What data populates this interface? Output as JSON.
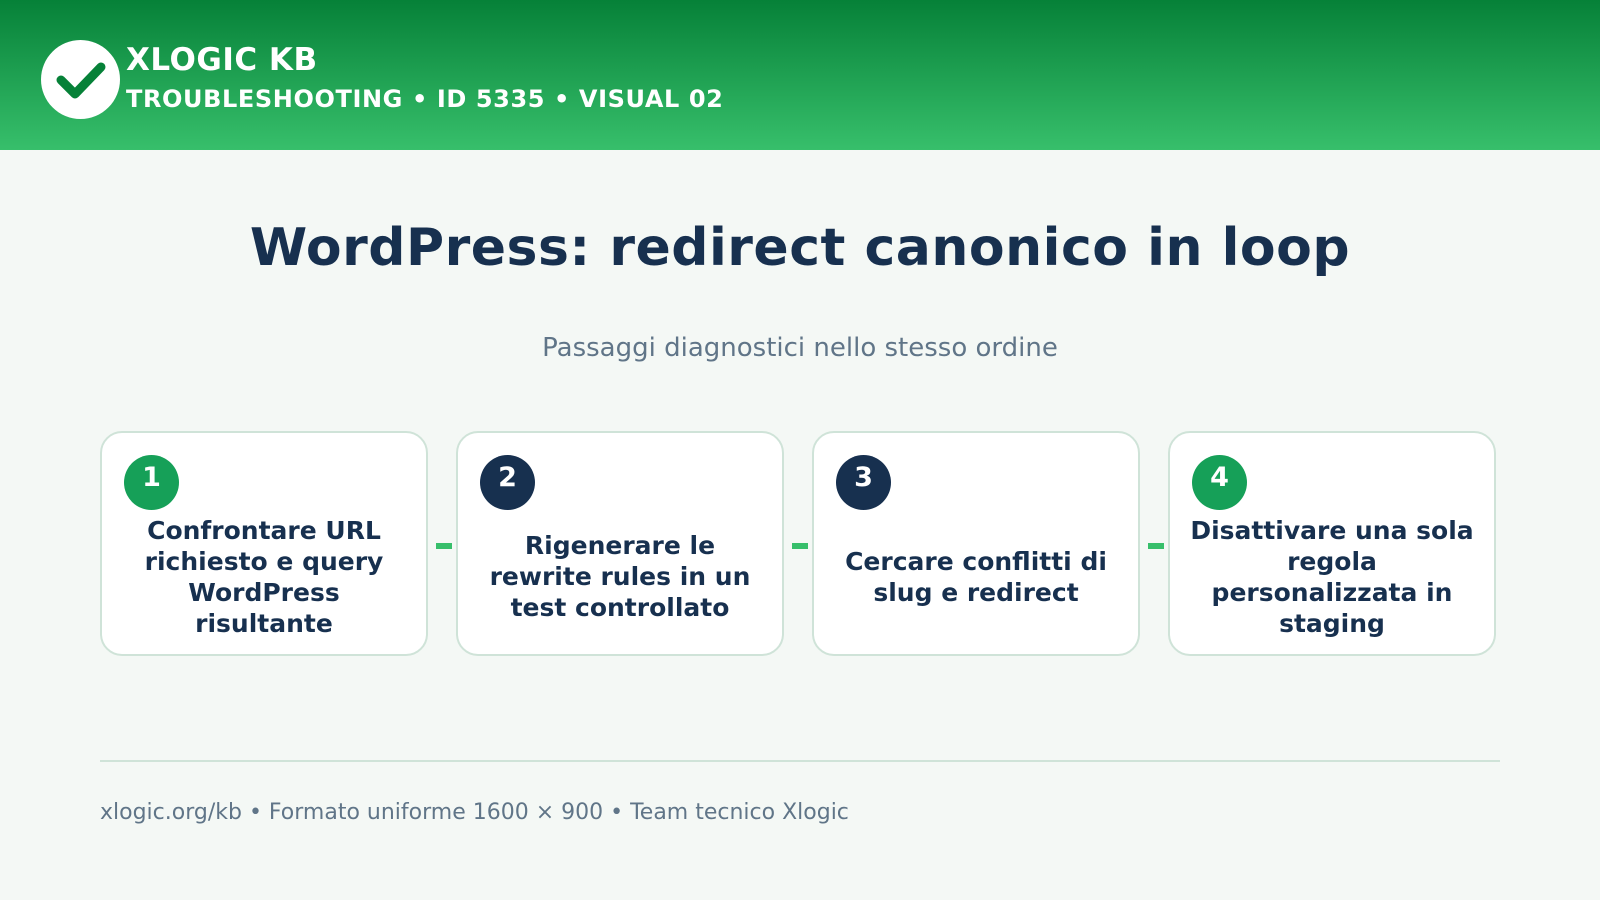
{
  "header": {
    "brand": "XLOGIC KB",
    "breadcrumb": "TROUBLESHOOTING • ID 5335 • VISUAL 02",
    "logo_icon": "checkmark-icon"
  },
  "main": {
    "title": "WordPress: redirect canonico in loop",
    "subtitle": "Passaggi diagnostici nello stesso ordine",
    "steps": [
      {
        "number": "1",
        "text": "Confrontare URL richiesto e query WordPress risultante",
        "badge_color": "#16a058"
      },
      {
        "number": "2",
        "text": "Rigenerare le rewrite rules in un test controllato",
        "badge_color": "#17304f"
      },
      {
        "number": "3",
        "text": "Cercare conflitti di slug e redirect",
        "badge_color": "#17304f"
      },
      {
        "number": "4",
        "text": "Disattivare una sola regola personalizzata in staging",
        "badge_color": "#16a058"
      }
    ]
  },
  "footer": {
    "text": "xlogic.org/kb • Formato uniforme 1600 × 900 • Team tecnico Xlogic"
  },
  "colors": {
    "header_gradient_start": "#068138",
    "header_gradient_end": "#37bf6b",
    "title": "#17304f",
    "muted": "#607588",
    "accent": "#37bf6b",
    "background": "#f4f8f5"
  }
}
